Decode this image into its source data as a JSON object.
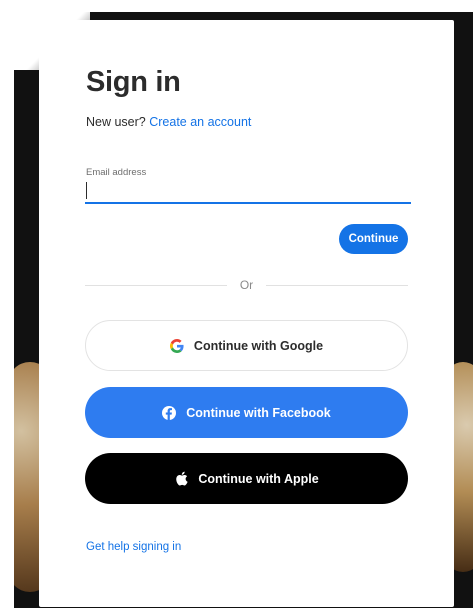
{
  "signin": {
    "title": "Sign in",
    "new_user_text": "New user?",
    "create_account_link": "Create an account",
    "email_label": "Email address",
    "email_value": "",
    "continue_label": "Continue",
    "divider_text": "Or",
    "google_label": "Continue with Google",
    "facebook_label": "Continue with Facebook",
    "apple_label": "Continue with Apple",
    "help_link": "Get help signing in"
  },
  "icons": {
    "google": "google-icon",
    "facebook": "facebook-icon",
    "apple": "apple-icon"
  },
  "colors": {
    "accent": "#1473e6",
    "facebook": "#2e7cf0",
    "apple": "#000000",
    "google_blue": "#4285f4",
    "google_red": "#ea4335",
    "google_yellow": "#fbbc05",
    "google_green": "#34a853"
  }
}
